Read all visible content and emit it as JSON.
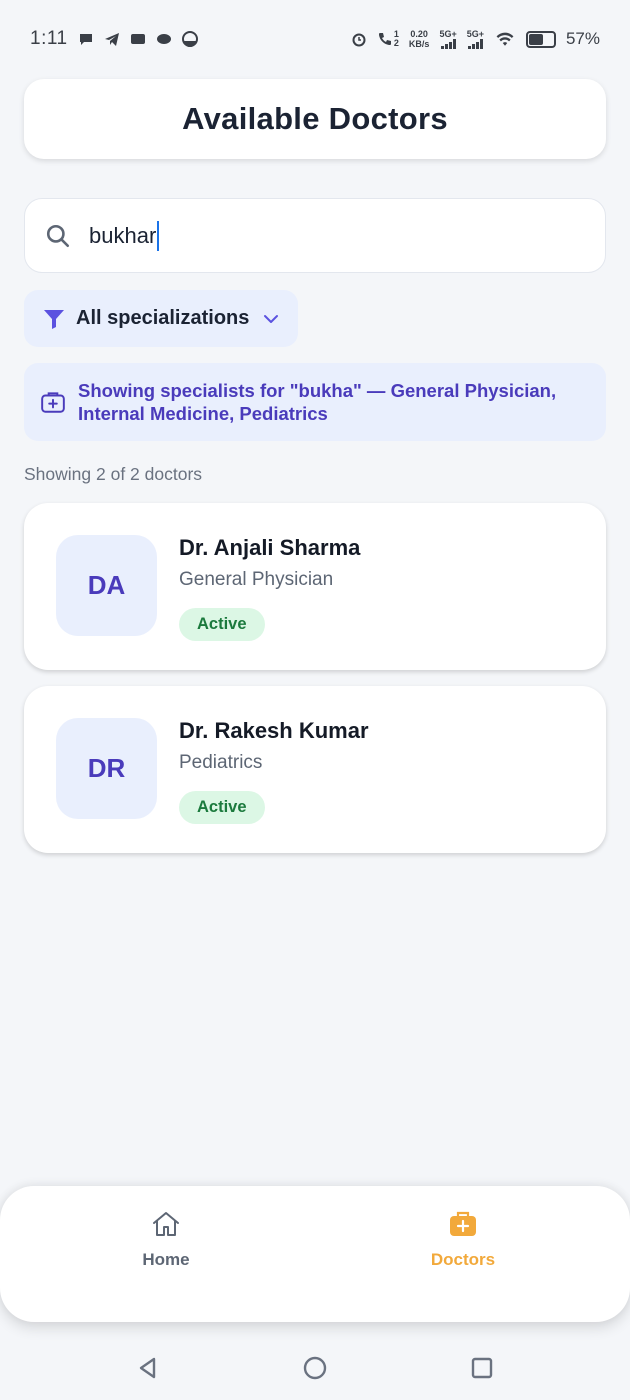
{
  "status_bar": {
    "time": "1:11",
    "net_speed_value": "0.20",
    "net_speed_unit": "KB/s",
    "signal1_label": "5G+",
    "signal2_label": "5G+",
    "sim_label_1": "1",
    "sim_label_2": "2",
    "battery_percent": "57%"
  },
  "header": {
    "title": "Available Doctors"
  },
  "search": {
    "value": "bukhar",
    "icon": "search-icon"
  },
  "filter": {
    "label": "All specializations",
    "icon": "filter-icon"
  },
  "info_banner": {
    "text": "Showing specialists for \"bukha\" — General Physician, Internal Medicine, Pediatrics",
    "icon": "medical-bag-icon"
  },
  "results": {
    "count_text": "Showing 2 of 2 doctors"
  },
  "doctors": [
    {
      "initials": "DA",
      "name": "Dr. Anjali Sharma",
      "specialization": "General Physician",
      "status": "Active"
    },
    {
      "initials": "DR",
      "name": "Dr. Rakesh Kumar",
      "specialization": "Pediatrics",
      "status": "Active"
    }
  ],
  "bottom_nav": {
    "items": [
      {
        "label": "Home",
        "icon": "home-icon",
        "active": false
      },
      {
        "label": "Doctors",
        "icon": "medical-bag-icon",
        "active": true
      }
    ]
  },
  "colors": {
    "accent": "#4a3bbb",
    "active_nav": "#f2a93b",
    "badge_bg": "#dcf7e5",
    "badge_text": "#1b7a3d",
    "chip_bg": "#e9effd"
  }
}
